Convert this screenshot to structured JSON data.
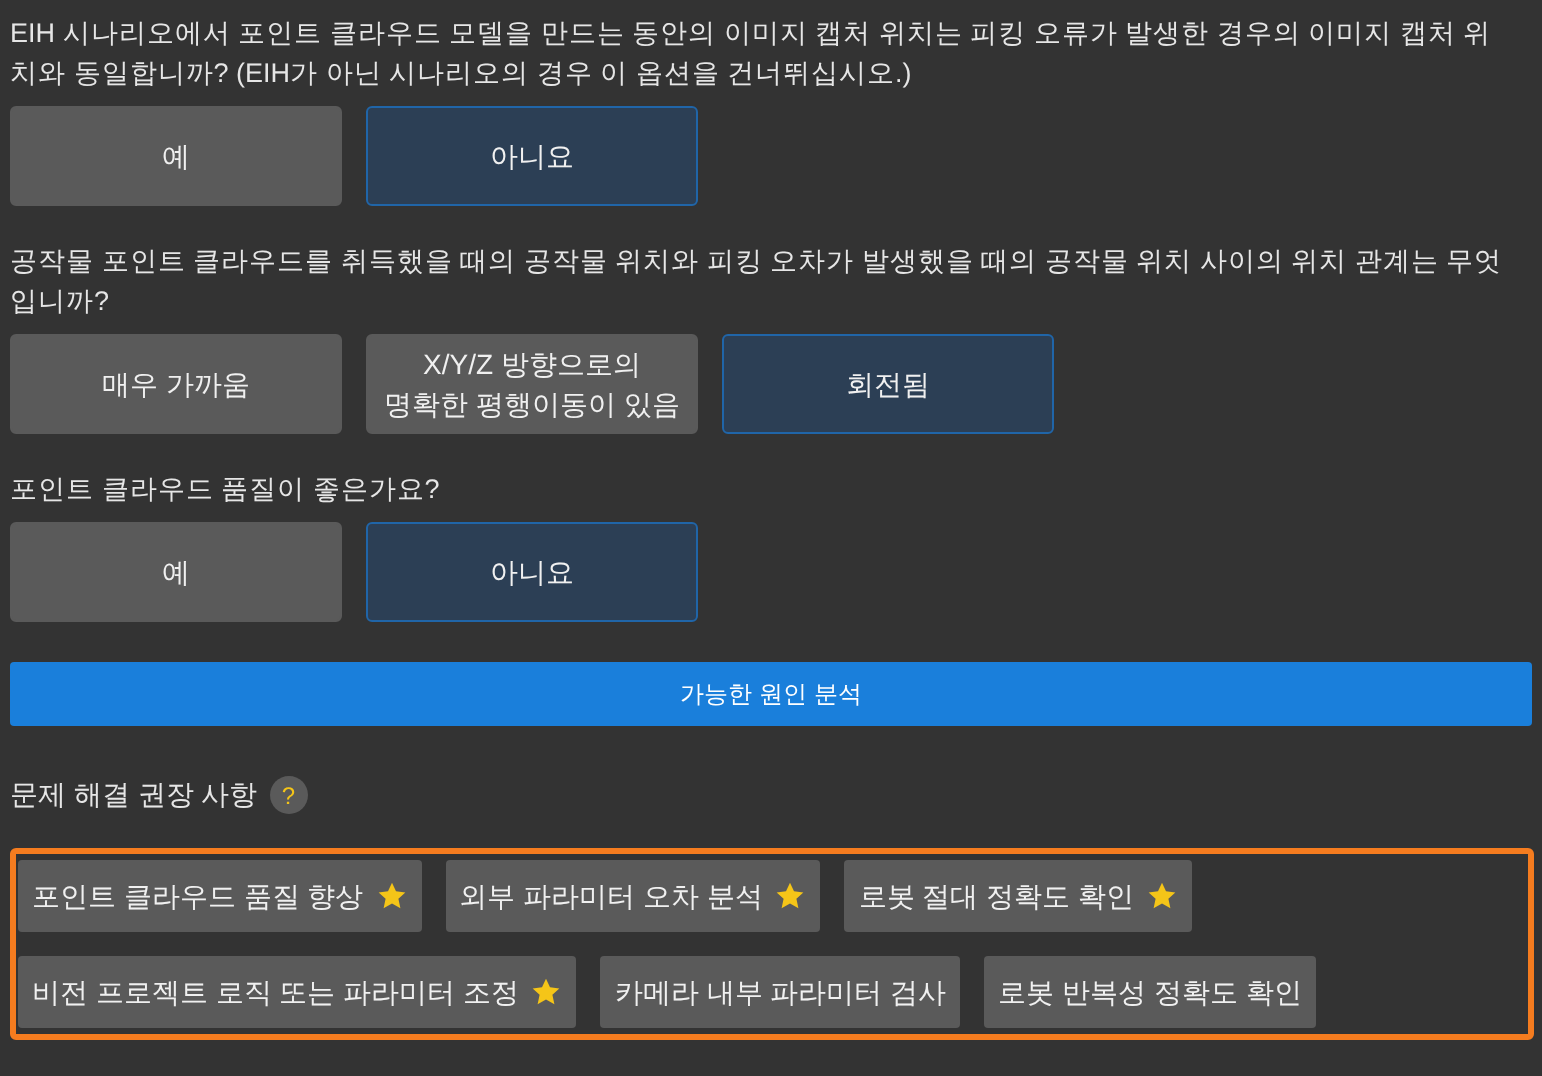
{
  "questions": [
    {
      "text": "EIH 시나리오에서 포인트 클라우드 모델을 만드는 동안의 이미지 캡처 위치는 피킹 오류가 발생한 경우의 이미지 캡처 위치와 동일합니까? (EIH가 아닌 시나리오의 경우 이 옵션을 건너뛰십시오.)",
      "options": [
        {
          "label": "예",
          "selected": false
        },
        {
          "label": "아니요",
          "selected": true
        }
      ]
    },
    {
      "text": "공작물 포인트 클라우드를 취득했을 때의 공작물 위치와 피킹 오차가 발생했을 때의 공작물 위치 사이의 위치 관계는 무엇입니까?",
      "options": [
        {
          "label": "매우 가까움",
          "selected": false
        },
        {
          "label": "X/Y/Z 방향으로의\n명확한 평행이동이 있음",
          "selected": false
        },
        {
          "label": "회전됨",
          "selected": true
        }
      ]
    },
    {
      "text": "포인트 클라우드 품질이 좋은가요?",
      "options": [
        {
          "label": "예",
          "selected": false
        },
        {
          "label": "아니요",
          "selected": true
        }
      ]
    }
  ],
  "analyze_button": "가능한 원인 분석",
  "recommendations": {
    "title": "문제 해결 권장 사항",
    "help": "?",
    "items": [
      {
        "label": "포인트 클라우드 품질 향상",
        "starred": true
      },
      {
        "label": "외부 파라미터 오차 분석",
        "starred": true
      },
      {
        "label": "로봇 절대 정확도 확인",
        "starred": true
      },
      {
        "label": "비전 프로젝트 로직 또는 파라미터 조정",
        "starred": true
      },
      {
        "label": "카메라 내부 파라미터 검사",
        "starred": false
      },
      {
        "label": "로봇 반복성 정확도 확인",
        "starred": false
      }
    ]
  }
}
